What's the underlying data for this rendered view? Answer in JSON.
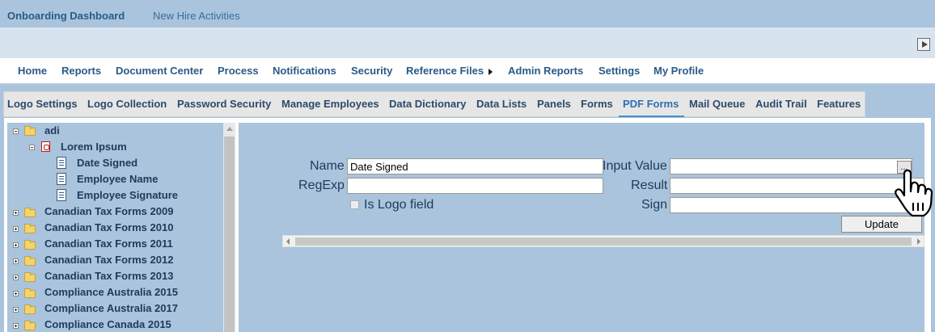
{
  "header": {
    "brand": "Onboarding Dashboard",
    "subtitle": "New Hire Activities"
  },
  "menu": {
    "items": [
      "Home",
      "Reports",
      "Document Center",
      "Process",
      "Notifications",
      "Security",
      "Reference Files",
      "Admin Reports",
      "Settings",
      "My Profile"
    ]
  },
  "tabs": {
    "items": [
      "Logo Settings",
      "Logo Collection",
      "Password Security",
      "Manage Employees",
      "Data Dictionary",
      "Data Lists",
      "Panels",
      "Forms",
      "PDF Forms",
      "Mail Queue",
      "Audit Trail",
      "Features"
    ],
    "active": "PDF Forms"
  },
  "tree": {
    "root": "adi",
    "form": "Lorem Ipsum",
    "fields": [
      "Date Signed",
      "Employee Name",
      "Employee Signature"
    ],
    "folders": [
      "Canadian Tax Forms 2009",
      "Canadian Tax Forms 2010",
      "Canadian Tax Forms 2011",
      "Canadian Tax Forms 2012",
      "Canadian Tax Forms 2013",
      "Compliance Australia 2015",
      "Compliance Australia 2017",
      "Compliance Canada 2015"
    ]
  },
  "form": {
    "name_label": "Name",
    "name_value": "Date Signed",
    "regexp_label": "RegExp",
    "regexp_value": "",
    "is_logo_label": "Is Logo field",
    "input_value_label": "Input Value",
    "input_value": "",
    "browse_label": "...",
    "result_label": "Result",
    "result_value": "",
    "sign_label": "Sign",
    "sign_value": "",
    "update_label": "Update"
  },
  "colors": {
    "accent": "#2f6fb0",
    "background": "#a9c4dc",
    "link": "#2a5a86"
  }
}
